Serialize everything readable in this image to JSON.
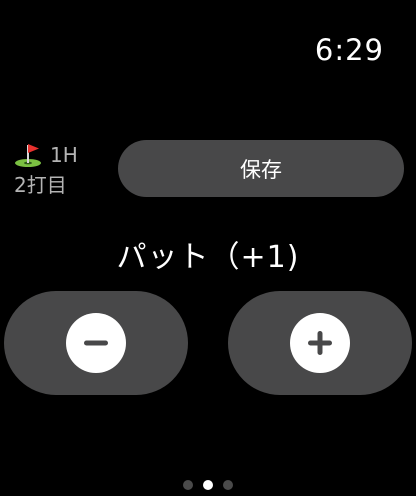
{
  "status": {
    "time": "6:29"
  },
  "hole": {
    "flag_icon": "golf-flag-icon",
    "number": "1H",
    "stroke": "2打目"
  },
  "actions": {
    "save_label": "保存"
  },
  "putt": {
    "title": "パット（+1)",
    "minus_icon": "minus-icon",
    "plus_icon": "plus-icon"
  },
  "pager": {
    "count": 3,
    "active_index": 1
  },
  "colors": {
    "background": "#000000",
    "button": "#484849",
    "text_primary": "#ffffff",
    "text_secondary": "#b4b4b4",
    "flag_red": "#e8312e",
    "green": "#7bc142"
  }
}
